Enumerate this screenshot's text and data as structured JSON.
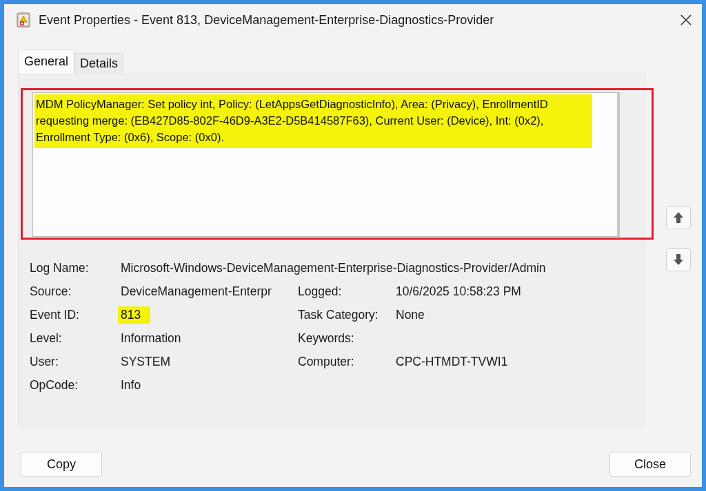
{
  "window": {
    "title": "Event Properties - Event 813, DeviceManagement-Enterprise-Diagnostics-Provider"
  },
  "tabs": [
    {
      "label": "General",
      "selected": true
    },
    {
      "label": "Details",
      "selected": false
    }
  ],
  "description": {
    "text": "MDM PolicyManager: Set policy int, Policy: (LetAppsGetDiagnosticInfo), Area: (Privacy), EnrollmentID requesting merge: (EB427D85-802F-46D9-A3E2-D5B414587F63), Current User: (Device), Int: (0x2), Enrollment Type: (0x6), Scope: (0x0).",
    "highlighted": true
  },
  "fields": [
    {
      "left": {
        "label": "Log Name:",
        "value": "Microsoft-Windows-DeviceManagement-Enterprise-Diagnostics-Provider/Admin",
        "highlighted": false
      }
    },
    {
      "left": {
        "label": "Source:",
        "value": "DeviceManagement-Enterpr",
        "highlighted": false
      },
      "right": {
        "label": "Logged:",
        "value": "10/6/2025 10:58:23 PM",
        "highlighted": false
      }
    },
    {
      "left": {
        "label": "Event ID:",
        "value": "813",
        "highlighted": true
      },
      "right": {
        "label": "Task Category:",
        "value": "None",
        "highlighted": false
      }
    },
    {
      "left": {
        "label": "Level:",
        "value": "Information",
        "highlighted": false
      },
      "right": {
        "label": "Keywords:"
      }
    },
    {
      "left": {
        "label": "User:",
        "value": "SYSTEM",
        "highlighted": false
      },
      "right": {
        "label": "Computer:",
        "value": "CPC-HTMDT-TVWI1",
        "highlighted": false
      }
    },
    {
      "left": {
        "label": "OpCode:",
        "value": "Info",
        "highlighted": false
      }
    }
  ],
  "buttons": [
    {
      "label": "Copy"
    },
    {
      "label": "Close"
    }
  ]
}
